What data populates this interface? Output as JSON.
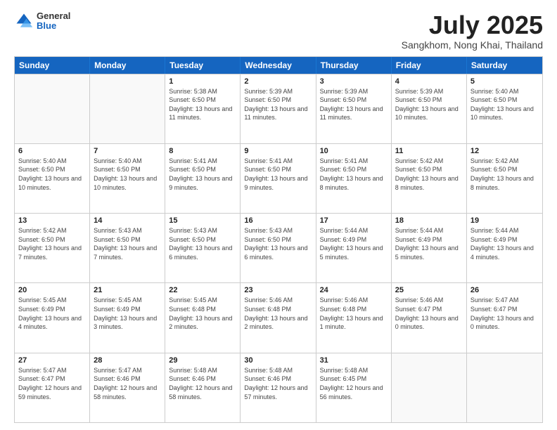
{
  "logo": {
    "general": "General",
    "blue": "Blue"
  },
  "title": "July 2025",
  "subtitle": "Sangkhom, Nong Khai, Thailand",
  "days_of_week": [
    "Sunday",
    "Monday",
    "Tuesday",
    "Wednesday",
    "Thursday",
    "Friday",
    "Saturday"
  ],
  "weeks": [
    [
      {
        "day": "",
        "empty": true
      },
      {
        "day": "",
        "empty": true
      },
      {
        "day": "1",
        "sunrise": "5:38 AM",
        "sunset": "6:50 PM",
        "daylight": "13 hours and 11 minutes."
      },
      {
        "day": "2",
        "sunrise": "5:39 AM",
        "sunset": "6:50 PM",
        "daylight": "13 hours and 11 minutes."
      },
      {
        "day": "3",
        "sunrise": "5:39 AM",
        "sunset": "6:50 PM",
        "daylight": "13 hours and 11 minutes."
      },
      {
        "day": "4",
        "sunrise": "5:39 AM",
        "sunset": "6:50 PM",
        "daylight": "13 hours and 10 minutes."
      },
      {
        "day": "5",
        "sunrise": "5:40 AM",
        "sunset": "6:50 PM",
        "daylight": "13 hours and 10 minutes."
      }
    ],
    [
      {
        "day": "6",
        "sunrise": "5:40 AM",
        "sunset": "6:50 PM",
        "daylight": "13 hours and 10 minutes."
      },
      {
        "day": "7",
        "sunrise": "5:40 AM",
        "sunset": "6:50 PM",
        "daylight": "13 hours and 10 minutes."
      },
      {
        "day": "8",
        "sunrise": "5:41 AM",
        "sunset": "6:50 PM",
        "daylight": "13 hours and 9 minutes."
      },
      {
        "day": "9",
        "sunrise": "5:41 AM",
        "sunset": "6:50 PM",
        "daylight": "13 hours and 9 minutes."
      },
      {
        "day": "10",
        "sunrise": "5:41 AM",
        "sunset": "6:50 PM",
        "daylight": "13 hours and 8 minutes."
      },
      {
        "day": "11",
        "sunrise": "5:42 AM",
        "sunset": "6:50 PM",
        "daylight": "13 hours and 8 minutes."
      },
      {
        "day": "12",
        "sunrise": "5:42 AM",
        "sunset": "6:50 PM",
        "daylight": "13 hours and 8 minutes."
      }
    ],
    [
      {
        "day": "13",
        "sunrise": "5:42 AM",
        "sunset": "6:50 PM",
        "daylight": "13 hours and 7 minutes."
      },
      {
        "day": "14",
        "sunrise": "5:43 AM",
        "sunset": "6:50 PM",
        "daylight": "13 hours and 7 minutes."
      },
      {
        "day": "15",
        "sunrise": "5:43 AM",
        "sunset": "6:50 PM",
        "daylight": "13 hours and 6 minutes."
      },
      {
        "day": "16",
        "sunrise": "5:43 AM",
        "sunset": "6:50 PM",
        "daylight": "13 hours and 6 minutes."
      },
      {
        "day": "17",
        "sunrise": "5:44 AM",
        "sunset": "6:49 PM",
        "daylight": "13 hours and 5 minutes."
      },
      {
        "day": "18",
        "sunrise": "5:44 AM",
        "sunset": "6:49 PM",
        "daylight": "13 hours and 5 minutes."
      },
      {
        "day": "19",
        "sunrise": "5:44 AM",
        "sunset": "6:49 PM",
        "daylight": "13 hours and 4 minutes."
      }
    ],
    [
      {
        "day": "20",
        "sunrise": "5:45 AM",
        "sunset": "6:49 PM",
        "daylight": "13 hours and 4 minutes."
      },
      {
        "day": "21",
        "sunrise": "5:45 AM",
        "sunset": "6:49 PM",
        "daylight": "13 hours and 3 minutes."
      },
      {
        "day": "22",
        "sunrise": "5:45 AM",
        "sunset": "6:48 PM",
        "daylight": "13 hours and 2 minutes."
      },
      {
        "day": "23",
        "sunrise": "5:46 AM",
        "sunset": "6:48 PM",
        "daylight": "13 hours and 2 minutes."
      },
      {
        "day": "24",
        "sunrise": "5:46 AM",
        "sunset": "6:48 PM",
        "daylight": "13 hours and 1 minute."
      },
      {
        "day": "25",
        "sunrise": "5:46 AM",
        "sunset": "6:47 PM",
        "daylight": "13 hours and 0 minutes."
      },
      {
        "day": "26",
        "sunrise": "5:47 AM",
        "sunset": "6:47 PM",
        "daylight": "13 hours and 0 minutes."
      }
    ],
    [
      {
        "day": "27",
        "sunrise": "5:47 AM",
        "sunset": "6:47 PM",
        "daylight": "12 hours and 59 minutes."
      },
      {
        "day": "28",
        "sunrise": "5:47 AM",
        "sunset": "6:46 PM",
        "daylight": "12 hours and 58 minutes."
      },
      {
        "day": "29",
        "sunrise": "5:48 AM",
        "sunset": "6:46 PM",
        "daylight": "12 hours and 58 minutes."
      },
      {
        "day": "30",
        "sunrise": "5:48 AM",
        "sunset": "6:46 PM",
        "daylight": "12 hours and 57 minutes."
      },
      {
        "day": "31",
        "sunrise": "5:48 AM",
        "sunset": "6:45 PM",
        "daylight": "12 hours and 56 minutes."
      },
      {
        "day": "",
        "empty": true
      },
      {
        "day": "",
        "empty": true
      }
    ]
  ],
  "labels": {
    "sunrise": "Sunrise:",
    "sunset": "Sunset:",
    "daylight": "Daylight:"
  }
}
